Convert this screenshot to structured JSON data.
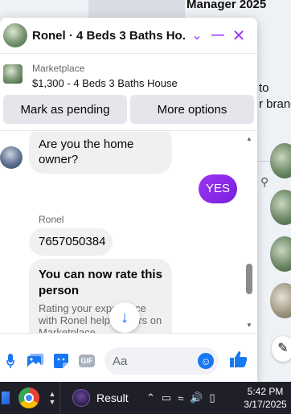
{
  "background": {
    "listing_title": "Manager 2025",
    "listing_sub": "...",
    "partial_text_1": "to",
    "partial_text_2": "r brand",
    "edit_icon": "edit-icon"
  },
  "chat": {
    "title": "Ronel · 4 Beds 3 Baths Ho...",
    "header_buttons": [
      "chevron-down-icon",
      "minimize-icon",
      "close-icon"
    ],
    "marketplace": {
      "label": "Marketplace",
      "item": "$1,300 - 4 Beds 3 Baths House"
    },
    "actions": {
      "mark_pending": "Mark as pending",
      "more_options": "More options"
    },
    "messages": {
      "incoming_1": "Are you the home owner?",
      "outgoing_1": "YES",
      "sender_name": "Ronel",
      "incoming_2": "7657050384",
      "rate_title": "You can now rate this person",
      "rate_body": "Rating your experience with Ronel helps others on Marketplace."
    },
    "composer": {
      "placeholder": "Aa",
      "icons": [
        "microphone-icon",
        "photo-icon",
        "sticker-icon",
        "gif-icon",
        "emoji-icon",
        "like-icon"
      ],
      "gif_label": "GIF"
    }
  },
  "taskbar": {
    "result_label": "Result",
    "time": "5:42 PM",
    "date": "3/17/2025"
  },
  "colors": {
    "accent": "#a334fa",
    "bubble_out": "#8a2be2",
    "messenger_blue": "#1877f2",
    "taskbar_bg": "#1f1f2a"
  }
}
